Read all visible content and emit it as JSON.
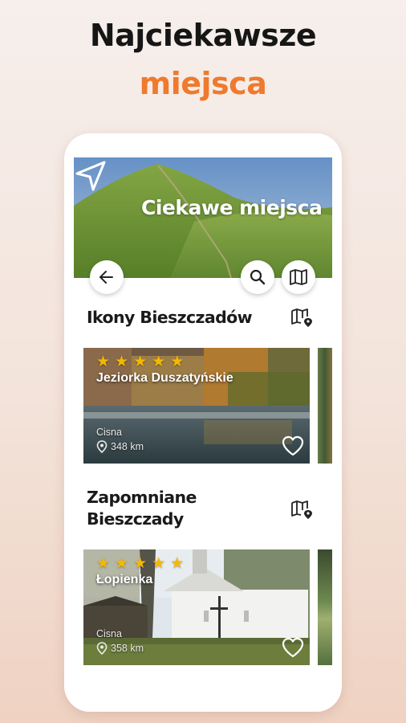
{
  "promo": {
    "line1": "Najciekawsze",
    "line2": "miejsca"
  },
  "colors": {
    "accent": "#ef7a2d",
    "star": "#f5b800",
    "text_dark": "#1a1a1a"
  },
  "header": {
    "title": "Ciekawe miejsca",
    "nav_icon": "navigation-arrow-icon"
  },
  "toolbar": {
    "back_icon": "arrow-left-icon",
    "search_icon": "search-icon",
    "map_icon": "map-icon"
  },
  "sections": [
    {
      "title": "Ikony Bieszczadów",
      "map_icon": "map-pin-icon",
      "cards": [
        {
          "name": "Jeziorka Duszatyńskie",
          "rating": 5,
          "town": "Cisna",
          "distance": "348 km",
          "favorite_icon": "heart-outline-icon"
        }
      ]
    },
    {
      "title": "Zapomniane Bieszczady",
      "title_lines": [
        "Zapomniane",
        "Bieszczady"
      ],
      "map_icon": "map-pin-icon",
      "cards": [
        {
          "name": "Łopienka",
          "rating": 5,
          "town": "Cisna",
          "distance": "358 km",
          "favorite_icon": "heart-outline-icon"
        }
      ]
    }
  ]
}
